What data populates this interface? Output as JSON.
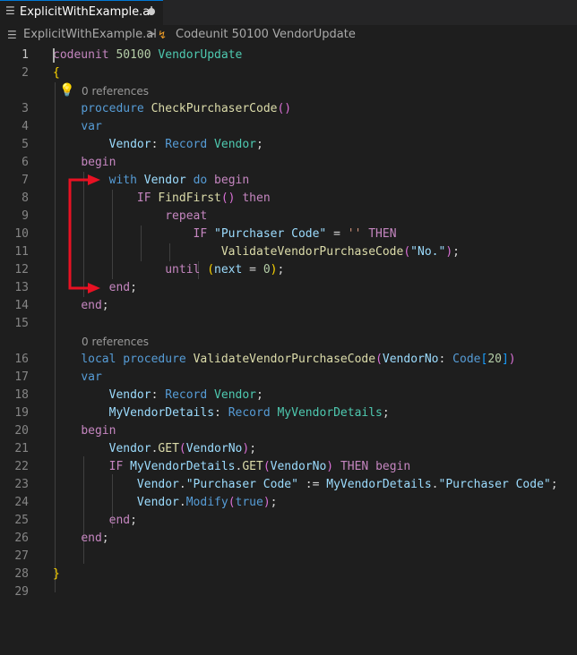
{
  "tab": {
    "label": "ExplicitWithExample.al",
    "icon": "file-icon",
    "dirty": true
  },
  "breadcrumb": {
    "file": "ExplicitWithExample.al",
    "separator": ">",
    "symbol": "Codeunit 50100 VendorUpdate",
    "symbol_icon": "symbol-class-icon"
  },
  "editor": {
    "active_line": 1,
    "codelens": [
      "0 references",
      "0 references"
    ],
    "lines": [
      {
        "n": "1",
        "text": "codeunit 50100 VendorUpdate"
      },
      {
        "n": "2",
        "text": "{"
      },
      {
        "n": "3",
        "text": "    procedure CheckPurchaserCode()"
      },
      {
        "n": "4",
        "text": "    var"
      },
      {
        "n": "5",
        "text": "        Vendor: Record Vendor;"
      },
      {
        "n": "6",
        "text": "    begin"
      },
      {
        "n": "7",
        "text": "        with Vendor do begin"
      },
      {
        "n": "8",
        "text": "            IF FindFirst() then"
      },
      {
        "n": "9",
        "text": "                repeat"
      },
      {
        "n": "10",
        "text": "                    IF \"Purchaser Code\" = '' THEN"
      },
      {
        "n": "11",
        "text": "                        ValidateVendorPurchaseCode(\"No.\");"
      },
      {
        "n": "12",
        "text": "                until (next = 0);"
      },
      {
        "n": "13",
        "text": "        end;"
      },
      {
        "n": "14",
        "text": "    end;"
      },
      {
        "n": "15",
        "text": ""
      },
      {
        "n": "16",
        "text": "    local procedure ValidateVendorPurchaseCode(VendorNo: Code[20])"
      },
      {
        "n": "17",
        "text": "    var"
      },
      {
        "n": "18",
        "text": "        Vendor: Record Vendor;"
      },
      {
        "n": "19",
        "text": "        MyVendorDetails: Record MyVendorDetails;"
      },
      {
        "n": "20",
        "text": "    begin"
      },
      {
        "n": "21",
        "text": "        Vendor.GET(VendorNo);"
      },
      {
        "n": "22",
        "text": "        IF MyVendorDetails.GET(VendorNo) THEN begin"
      },
      {
        "n": "23",
        "text": "            Vendor.\"Purchaser Code\" := MyVendorDetails.\"Purchaser Code\";"
      },
      {
        "n": "24",
        "text": "            Vendor.Modify(true);"
      },
      {
        "n": "25",
        "text": "        end;"
      },
      {
        "n": "26",
        "text": "    end;"
      },
      {
        "n": "27",
        "text": ""
      },
      {
        "n": "28",
        "text": "}"
      },
      {
        "n": "29",
        "text": ""
      }
    ]
  },
  "annotation": {
    "color": "#e81123",
    "description_icon": "red-bracket-arrows-icon"
  },
  "lightbulb_icon": "lightbulb-icon"
}
